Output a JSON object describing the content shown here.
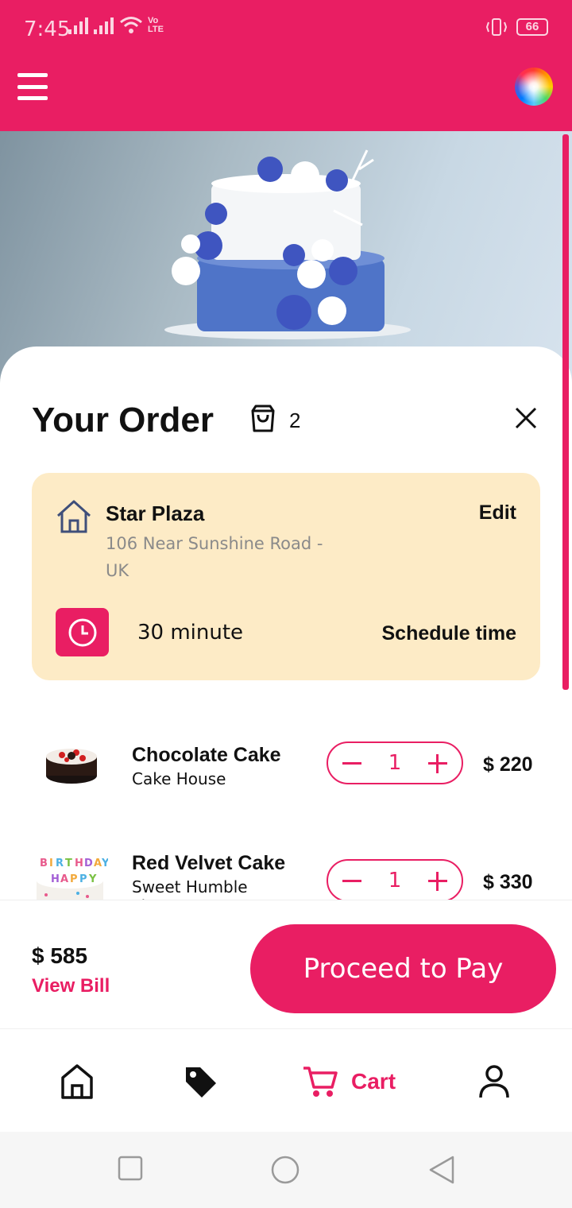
{
  "status_bar": {
    "time": "7:45",
    "network_label": "Vo LTE",
    "battery": "66"
  },
  "order": {
    "title": "Your Order",
    "item_count": "2"
  },
  "address": {
    "name": "Star Plaza",
    "line": "106 Near Sunshine Road - UK",
    "edit_label": "Edit",
    "delivery_time": "30 minute",
    "schedule_label": "Schedule time"
  },
  "items": [
    {
      "name": "Chocolate Cake",
      "shop": "Cake House",
      "qty": "1",
      "price": "$ 220"
    },
    {
      "name": "Red Velvet Cake",
      "shop": "Sweet Humble Pie",
      "qty": "1",
      "price": "$ 330"
    }
  ],
  "footer": {
    "total": "$ 585",
    "view_bill_label": "View Bill",
    "proceed_label": "Proceed to Pay"
  },
  "nav": {
    "items": [
      {
        "icon": "home-icon"
      },
      {
        "icon": "tag-icon"
      },
      {
        "icon": "cart-icon",
        "label": "Cart",
        "active": true
      },
      {
        "icon": "user-icon"
      }
    ]
  },
  "colors": {
    "accent": "#e91e63",
    "card": "#fdebc6"
  }
}
